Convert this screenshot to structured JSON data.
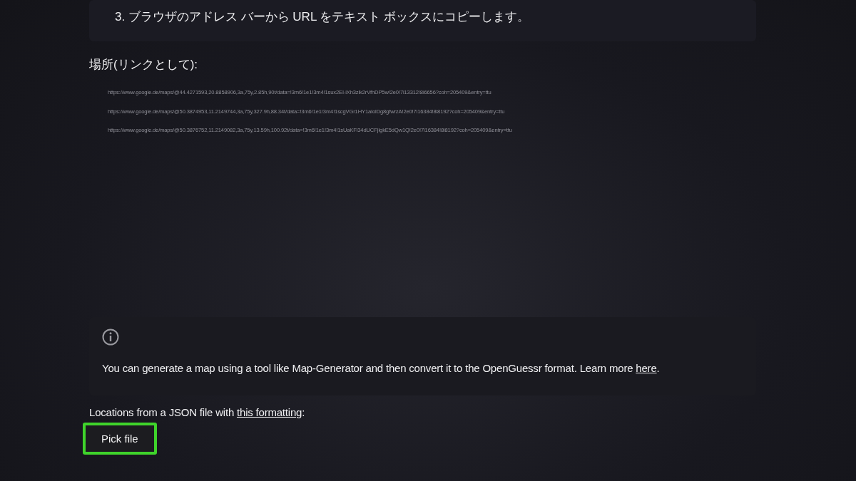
{
  "step": {
    "text": "3. ブラウザのアドレス バーから URL をテキスト ボックスにコピーします。"
  },
  "locations_label": "場所(リンクとして):",
  "locations_field": {
    "lines": [
      "https://www.google.de/maps/@44.4271593,20.8858906,3a,75y,2.85h,90t/data=!3m6!1e1!3m4!1sux2EI-iXh3zlk2rVfhDP5w!2e0!7i13312!8i6656?coh=205409&entry=ttu",
      "https://www.google.de/maps/@50.3874953,11.2149744,3a,75y,327.9h,88.34t/data=!3m6!1e1!3m4!1scgVGr1HY1aIolDg8gfwrzA!2e0!7i16384!8i8192?coh=205409&entry=ttu",
      "https://www.google.de/maps/@50.3876752,11.2149082,3a,75y,13.59h,100.92t/data=!3m6!1e1!3m4!1sUaKFi34dUCFjIgkE5dQw1Q!2e0!7i16384!8i8192?coh=205409&entry=ttu"
    ]
  },
  "info": {
    "text": "You can generate a map using a tool like Map-Generator and then convert it to the OpenGuessr format. Learn more ",
    "link": "here",
    "end": "."
  },
  "json_label": {
    "text": "Locations from a JSON file with ",
    "link": "this formatting",
    "end": ":"
  },
  "pick_button": {
    "label": "Pick file",
    "highlighted": true
  }
}
